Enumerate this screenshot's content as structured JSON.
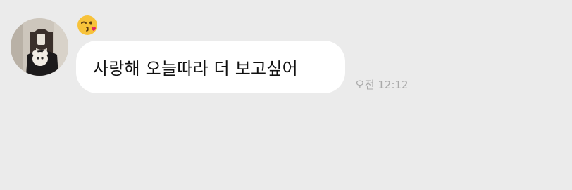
{
  "chat": {
    "sender": {
      "avatar_icon": "profile-photo-mirror-selfie"
    },
    "reaction": {
      "icon": "face-blowing-kiss-emoji"
    },
    "message": {
      "text": "사랑해 오늘따라 더 보고싶어",
      "time": "오전 12:12"
    }
  },
  "colors": {
    "background": "#ebebeb",
    "bubble": "#ffffff",
    "message_text": "#111111",
    "timestamp": "#a9a9a9"
  }
}
